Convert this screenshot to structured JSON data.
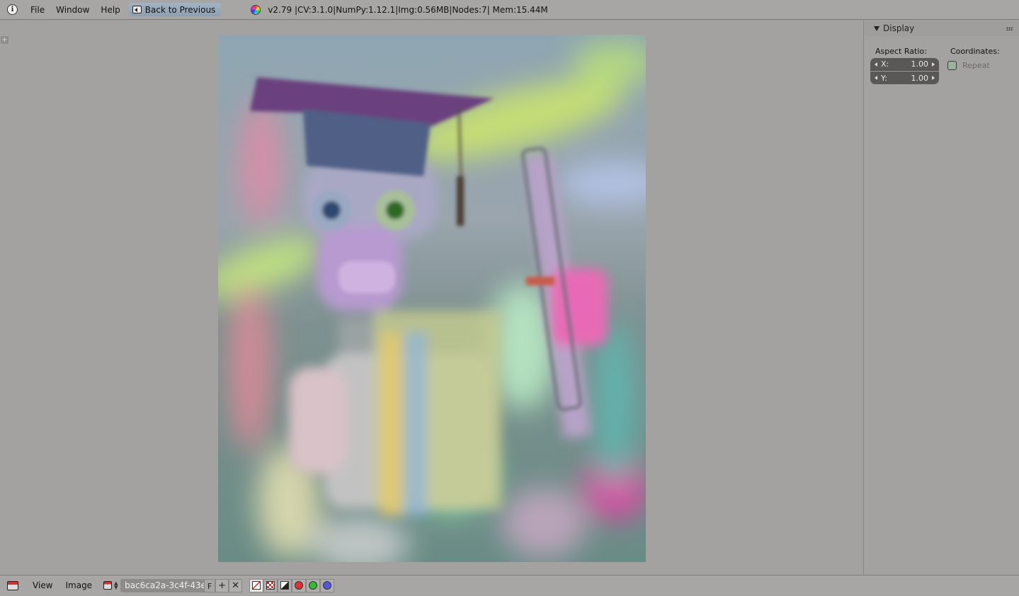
{
  "topbar": {
    "menu": [
      "File",
      "Window",
      "Help"
    ],
    "back_button": "Back to Previous",
    "status": "v2.79 |CV:3.1.0|NumPy:1.12.1|Img:0.56MB|Nodes:7| Mem:15.44M"
  },
  "panel": {
    "title": "Display",
    "aspect_label": "Aspect Ratio:",
    "x_label": "X:",
    "x_value": "1.00",
    "y_label": "Y:",
    "y_value": "1.00",
    "coords_label": "Coordinates:",
    "repeat_label": "Repeat",
    "repeat_checked": false
  },
  "bottombar": {
    "menu": [
      "View",
      "Image"
    ],
    "image_name": "bac6ca2a-3c4f-43e...",
    "fake_user": "F"
  },
  "colors": {
    "background": "#a4a2a1",
    "header": "#a8a6a5",
    "field": "#5a5857",
    "active_button": "#9aabbc"
  }
}
